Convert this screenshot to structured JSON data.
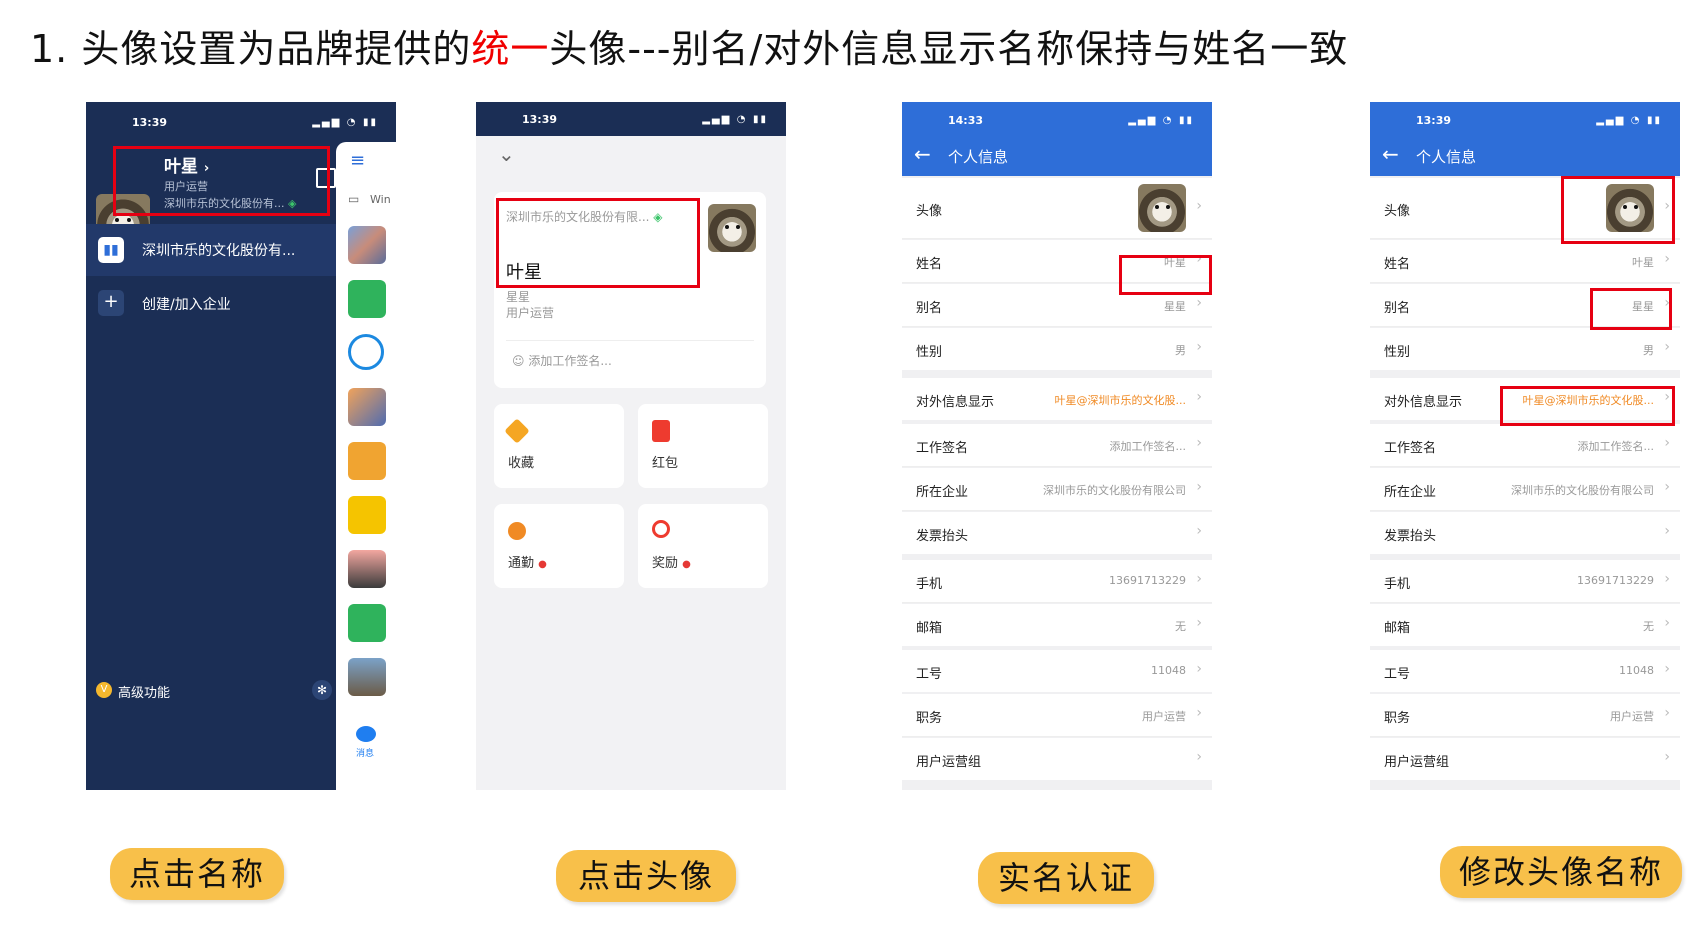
{
  "title": {
    "prefix": "1. 头像设置为品牌提供的",
    "highlight": "统一",
    "suffix": "头像---别名/对外信息显示名称保持与姓名一致"
  },
  "colors": {
    "highlight": "#f00000",
    "red_box": "#e60012",
    "pill": "#f8c04a",
    "blue_header": "#2e6ed8",
    "drawer_bg": "#1b2e55"
  },
  "steps": [
    "点击名称",
    "点击头像",
    "实名认证",
    "修改头像名称"
  ],
  "phone1": {
    "time": "13:39",
    "name": "叶星",
    "role": "用户运营",
    "company_short": "深圳市乐的文化股份有...",
    "org_item": "深圳市乐的文化股份有...",
    "create_join": "创建/加入企业",
    "advanced": "高级功能",
    "rail_label_win": "Win",
    "rail_label_msg": "消息"
  },
  "phone2": {
    "time": "13:39",
    "company": "深圳市乐的文化股份有限...",
    "name": "叶星",
    "alias": "星星",
    "role": "用户运营",
    "signature_placeholder": "添加工作签名...",
    "tiles": [
      "收藏",
      "红包",
      "通勤",
      "奖励"
    ]
  },
  "phone3": {
    "time": "14:33",
    "header": "个人信息",
    "rows": [
      {
        "k": "头像",
        "v": ""
      },
      {
        "k": "姓名",
        "v": "叶星"
      },
      {
        "k": "别名",
        "v": "星星"
      },
      {
        "k": "性别",
        "v": "男"
      },
      {
        "k": "对外信息显示",
        "v": "叶星@深圳市乐的文化股..."
      },
      {
        "k": "工作签名",
        "v": "添加工作签名..."
      },
      {
        "k": "所在企业",
        "v": "深圳市乐的文化股份有限公司"
      },
      {
        "k": "发票抬头",
        "v": ""
      },
      {
        "k": "手机",
        "v": "13691713229"
      },
      {
        "k": "邮箱",
        "v": "无"
      },
      {
        "k": "工号",
        "v": "11048"
      },
      {
        "k": "职务",
        "v": "用户运营"
      },
      {
        "k": "用户运营组",
        "v": ""
      }
    ]
  },
  "phone4": {
    "time": "13:39",
    "header": "个人信息",
    "rows": [
      {
        "k": "头像",
        "v": ""
      },
      {
        "k": "姓名",
        "v": "叶星"
      },
      {
        "k": "别名",
        "v": "星星"
      },
      {
        "k": "性别",
        "v": "男"
      },
      {
        "k": "对外信息显示",
        "v": "叶星@深圳市乐的文化股..."
      },
      {
        "k": "工作签名",
        "v": "添加工作签名..."
      },
      {
        "k": "所在企业",
        "v": "深圳市乐的文化股份有限公司"
      },
      {
        "k": "发票抬头",
        "v": ""
      },
      {
        "k": "手机",
        "v": "13691713229"
      },
      {
        "k": "邮箱",
        "v": "无"
      },
      {
        "k": "工号",
        "v": "11048"
      },
      {
        "k": "职务",
        "v": "用户运营"
      },
      {
        "k": "用户运营组",
        "v": ""
      }
    ]
  }
}
